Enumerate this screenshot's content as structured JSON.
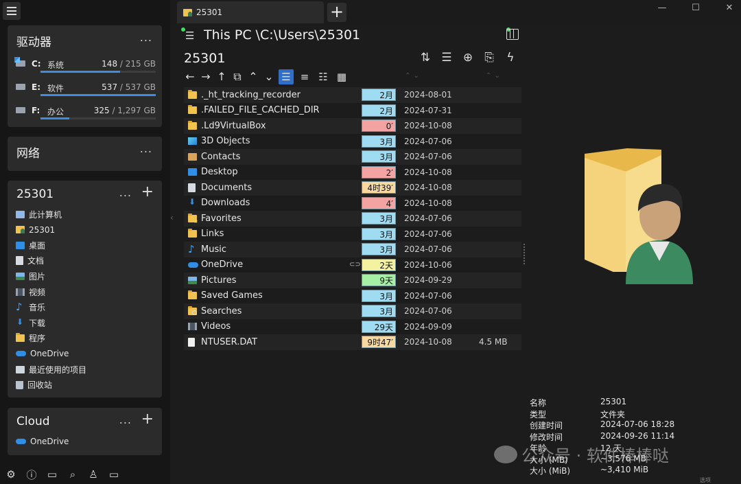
{
  "sidebar": {
    "drives_panel": {
      "title": "驱动器",
      "dots": "...",
      "drives": [
        {
          "letter": "C:",
          "name": "系统",
          "used": "148",
          "total": "215 GB",
          "used_fraction": 0.69
        },
        {
          "letter": "E:",
          "name": "软件",
          "used": "537",
          "total": "537 GB",
          "used_fraction": 1.0
        },
        {
          "letter": "F:",
          "name": "办公",
          "used": "325",
          "total": "1,297 GB",
          "used_fraction": 0.25
        }
      ]
    },
    "network_panel": {
      "title": "网络",
      "dots": "..."
    },
    "user_panel": {
      "title": "25301",
      "dots": "...",
      "plus": "+",
      "items": [
        {
          "label": "此计算机",
          "icon": "computer-icon"
        },
        {
          "label": "25301",
          "icon": "user-folder-icon"
        },
        {
          "label": "桌面",
          "icon": "desktop-icon"
        },
        {
          "label": "文档",
          "icon": "documents-icon"
        },
        {
          "label": "图片",
          "icon": "pictures-icon"
        },
        {
          "label": "视频",
          "icon": "videos-icon"
        },
        {
          "label": "音乐",
          "icon": "music-icon"
        },
        {
          "label": "下载",
          "icon": "downloads-icon"
        },
        {
          "label": "程序",
          "icon": "folder-icon"
        },
        {
          "label": "OneDrive",
          "icon": "onedrive-icon"
        },
        {
          "label": "最近使用的项目",
          "icon": "recent-items-icon"
        },
        {
          "label": "回收站",
          "icon": "recycle-bin-icon"
        }
      ]
    },
    "cloud_panel": {
      "title": "Cloud",
      "dots": "...",
      "plus": "+",
      "items": [
        {
          "label": "OneDrive",
          "icon": "onedrive-icon"
        }
      ]
    },
    "tools": [
      {
        "icon": "settings-icon",
        "glyph": "⚙"
      },
      {
        "icon": "info-icon",
        "glyph": "ⓘ"
      },
      {
        "icon": "dual-pane-icon",
        "glyph": "▭"
      },
      {
        "icon": "search-icon",
        "glyph": "⌕"
      },
      {
        "icon": "filter-icon",
        "glyph": "♙"
      },
      {
        "icon": "screen-icon",
        "glyph": "▭"
      }
    ]
  },
  "tabs": [
    {
      "label": "25301"
    }
  ],
  "tab_add": "+",
  "window": {
    "minimize": "—",
    "maximize": "☐",
    "close": "✕"
  },
  "pane": {
    "path": "This PC \\C:\\Users\\25301",
    "folder_title": "25301",
    "actions": [
      {
        "icon": "sort-icon",
        "glyph": "⇅"
      },
      {
        "icon": "list-options-icon",
        "glyph": "☰"
      },
      {
        "icon": "add-icon",
        "glyph": "⊕"
      },
      {
        "icon": "clipboard-icon",
        "glyph": "⎘"
      },
      {
        "icon": "flash-icon",
        "glyph": "ϟ"
      }
    ],
    "nav": [
      {
        "icon": "back-icon",
        "glyph": "←"
      },
      {
        "icon": "forward-icon",
        "glyph": "→"
      },
      {
        "icon": "up-icon",
        "glyph": "↑"
      },
      {
        "icon": "window-icon",
        "glyph": "⧉"
      },
      {
        "icon": "chevron-up-icon",
        "glyph": "⌃"
      },
      {
        "icon": "chevron-down-icon",
        "glyph": "⌄"
      }
    ],
    "views": [
      {
        "icon": "details-view-icon",
        "glyph": "☰",
        "active": true
      },
      {
        "icon": "list-view-icon",
        "glyph": "≡",
        "active": false
      },
      {
        "icon": "tiles-view-icon",
        "glyph": "☷",
        "active": false
      },
      {
        "icon": "grid-view-icon",
        "glyph": "▦",
        "active": false
      }
    ],
    "files": [
      {
        "name": "._ht_tracking_recorder",
        "icon": "folder",
        "age": "2月",
        "age_color": "#9fdcf2",
        "date": "2024-08-01",
        "size": ""
      },
      {
        "name": ".FAILED_FILE_CACHED_DIR",
        "icon": "folder",
        "age": "2月",
        "age_color": "#9fdcf2",
        "date": "2024-07-31",
        "size": ""
      },
      {
        "name": ".Ld9VirtualBox",
        "icon": "folder",
        "age": "0′",
        "age_color": "#f4a3a3",
        "date": "2024-10-08",
        "size": ""
      },
      {
        "name": "3D Objects",
        "icon": "cube",
        "age": "3月",
        "age_color": "#9fdcf2",
        "date": "2024-07-06",
        "size": ""
      },
      {
        "name": "Contacts",
        "icon": "contact",
        "age": "3月",
        "age_color": "#9fdcf2",
        "date": "2024-07-06",
        "size": ""
      },
      {
        "name": "Desktop",
        "icon": "blue",
        "age": "2′",
        "age_color": "#f4a3a3",
        "date": "2024-10-08",
        "size": ""
      },
      {
        "name": "Documents",
        "icon": "doc",
        "age": "4时39′",
        "age_color": "#f7d9a0",
        "date": "2024-10-08",
        "size": ""
      },
      {
        "name": "Downloads",
        "icon": "down",
        "age": "4′",
        "age_color": "#f4a3a3",
        "date": "2024-10-08",
        "size": ""
      },
      {
        "name": "Favorites",
        "icon": "folder fav",
        "age": "3月",
        "age_color": "#9fdcf2",
        "date": "2024-07-06",
        "size": ""
      },
      {
        "name": "Links",
        "icon": "folder",
        "age": "3月",
        "age_color": "#9fdcf2",
        "date": "2024-07-06",
        "size": ""
      },
      {
        "name": "Music",
        "icon": "music",
        "age": "3月",
        "age_color": "#9fdcf2",
        "date": "2024-07-06",
        "size": ""
      },
      {
        "name": "OneDrive",
        "icon": "cloud",
        "age": "2天",
        "age_color": "#f2f2a0",
        "date": "2024-10-06",
        "size": "",
        "linked": true
      },
      {
        "name": "Pictures",
        "icon": "pic",
        "age": "9天",
        "age_color": "#a6f0a6",
        "date": "2024-09-29",
        "size": ""
      },
      {
        "name": "Saved Games",
        "icon": "folder",
        "age": "3月",
        "age_color": "#9fdcf2",
        "date": "2024-07-06",
        "size": ""
      },
      {
        "name": "Searches",
        "icon": "folder search-f",
        "age": "3月",
        "age_color": "#9fdcf2",
        "date": "2024-07-06",
        "size": ""
      },
      {
        "name": "Videos",
        "icon": "video",
        "age": "29天",
        "age_color": "#9fdcf2",
        "date": "2024-09-09",
        "size": ""
      },
      {
        "name": "NTUSER.DAT",
        "icon": "file",
        "age": "9时47′",
        "age_color": "#f7d9a0",
        "date": "2024-10-08",
        "size": "4.5 MB"
      }
    ]
  },
  "preview": {
    "properties": [
      {
        "key": "名称",
        "value": "25301"
      },
      {
        "key": "类型",
        "value": "文件夹"
      },
      {
        "key": "创建时间",
        "value": "2024-07-06   18:28"
      },
      {
        "key": "修改时间",
        "value": "2024-09-26   11:14"
      },
      {
        "key": "年龄",
        "value": "12 天"
      },
      {
        "key": "大小 (MB)",
        "value": "~3,576 MB"
      },
      {
        "key": "大小 (MiB)",
        "value": "~3,410 MiB"
      }
    ],
    "watermark": "公众号 · 软件棒棒哒",
    "corner_label": "选项"
  }
}
